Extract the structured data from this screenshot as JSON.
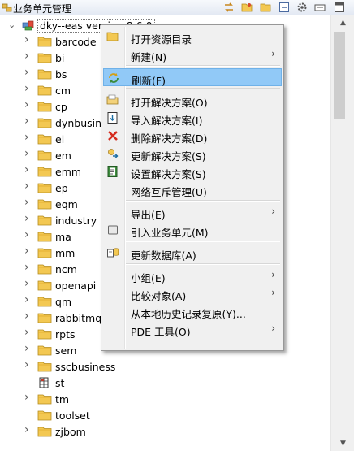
{
  "panel": {
    "title": "业务单元管理"
  },
  "tree": {
    "root": {
      "label": "dky--eas version:8.6.0"
    },
    "items": [
      {
        "label": "barcode",
        "type": "folder",
        "expandable": true
      },
      {
        "label": "bi",
        "type": "folder",
        "expandable": true
      },
      {
        "label": "bs",
        "type": "folder",
        "expandable": true
      },
      {
        "label": "cm",
        "type": "folder",
        "expandable": true
      },
      {
        "label": "cp",
        "type": "folder",
        "expandable": true
      },
      {
        "label": "dynbusine",
        "type": "folder",
        "expandable": true
      },
      {
        "label": "el",
        "type": "folder",
        "expandable": true
      },
      {
        "label": "em",
        "type": "folder",
        "expandable": true
      },
      {
        "label": "emm",
        "type": "folder",
        "expandable": true
      },
      {
        "label": "ep",
        "type": "folder",
        "expandable": true
      },
      {
        "label": "eqm",
        "type": "folder",
        "expandable": true
      },
      {
        "label": "industry",
        "type": "folder",
        "expandable": true
      },
      {
        "label": "ma",
        "type": "folder",
        "expandable": true
      },
      {
        "label": "mm",
        "type": "folder",
        "expandable": true
      },
      {
        "label": "ncm",
        "type": "folder",
        "expandable": true
      },
      {
        "label": "openapi",
        "type": "folder",
        "expandable": true
      },
      {
        "label": "qm",
        "type": "folder",
        "expandable": true
      },
      {
        "label": "rabbitmq",
        "type": "folder",
        "expandable": true
      },
      {
        "label": "rpts",
        "type": "folder",
        "expandable": true
      },
      {
        "label": "sem",
        "type": "folder",
        "expandable": true
      },
      {
        "label": "sscbusiness",
        "type": "folder",
        "expandable": true
      },
      {
        "label": "st",
        "type": "unit",
        "expandable": false
      },
      {
        "label": "tm",
        "type": "folder",
        "expandable": true
      },
      {
        "label": "toolset",
        "type": "folder",
        "expandable": false
      },
      {
        "label": "zjbom",
        "type": "folder",
        "expandable": true
      }
    ]
  },
  "context_menu": {
    "items": [
      {
        "label": "打开资源目录",
        "icon": "open-folder-icon",
        "submenu": false
      },
      {
        "label": "新建(N)",
        "icon": "",
        "submenu": true
      },
      {
        "separator": true
      },
      {
        "label": "刷新(F)",
        "icon": "refresh-icon",
        "submenu": false,
        "highlighted": true
      },
      {
        "separator": true
      },
      {
        "label": "打开解决方案(O)",
        "icon": "open-solution-icon",
        "submenu": false
      },
      {
        "label": "导入解决方案(I)",
        "icon": "import-icon",
        "submenu": false
      },
      {
        "label": "删除解决方案(D)",
        "icon": "delete-icon",
        "submenu": false
      },
      {
        "label": "更新解决方案(S)",
        "icon": "update-icon",
        "submenu": false
      },
      {
        "label": "设置解决方案(S)",
        "icon": "settings-icon",
        "submenu": false
      },
      {
        "label": "网络互斥管理(U)",
        "icon": "",
        "submenu": false
      },
      {
        "separator": true
      },
      {
        "label": "导出(E)",
        "icon": "",
        "submenu": true
      },
      {
        "label": "引入业务单元(M)",
        "icon": "import-unit-icon",
        "submenu": false
      },
      {
        "separator": true
      },
      {
        "label": "更新数据库(A)",
        "icon": "database-icon",
        "submenu": false
      },
      {
        "separator": true
      },
      {
        "label": "小组(E)",
        "icon": "",
        "submenu": true
      },
      {
        "label": "比较对象(A)",
        "icon": "",
        "submenu": true
      },
      {
        "label": "从本地历史记录复原(Y)...",
        "icon": "",
        "submenu": false
      },
      {
        "label": "PDE 工具(O)",
        "icon": "",
        "submenu": true
      }
    ]
  },
  "colors": {
    "highlight": "#91c9f7",
    "folder": "#f3c852",
    "menu_bg": "#f0f0f0"
  }
}
